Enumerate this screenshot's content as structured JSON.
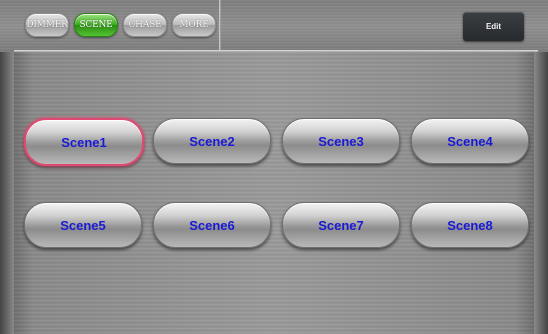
{
  "tabs": [
    {
      "label": "DIMMER",
      "active": false
    },
    {
      "label": "SCENE",
      "active": true
    },
    {
      "label": "CHASE",
      "active": false
    },
    {
      "label": "MORE",
      "active": false
    }
  ],
  "edit_label": "Edit",
  "scenes": [
    {
      "label": "Scene1",
      "selected": true
    },
    {
      "label": "Scene2",
      "selected": false
    },
    {
      "label": "Scene3",
      "selected": false
    },
    {
      "label": "Scene4",
      "selected": false
    },
    {
      "label": "Scene5",
      "selected": false
    },
    {
      "label": "Scene6",
      "selected": false
    },
    {
      "label": "Scene7",
      "selected": false
    },
    {
      "label": "Scene8",
      "selected": false
    }
  ],
  "colors": {
    "scene_text": "#1a1ad6",
    "active_tab": "#3fae20",
    "selected_border": "#e04a72"
  }
}
